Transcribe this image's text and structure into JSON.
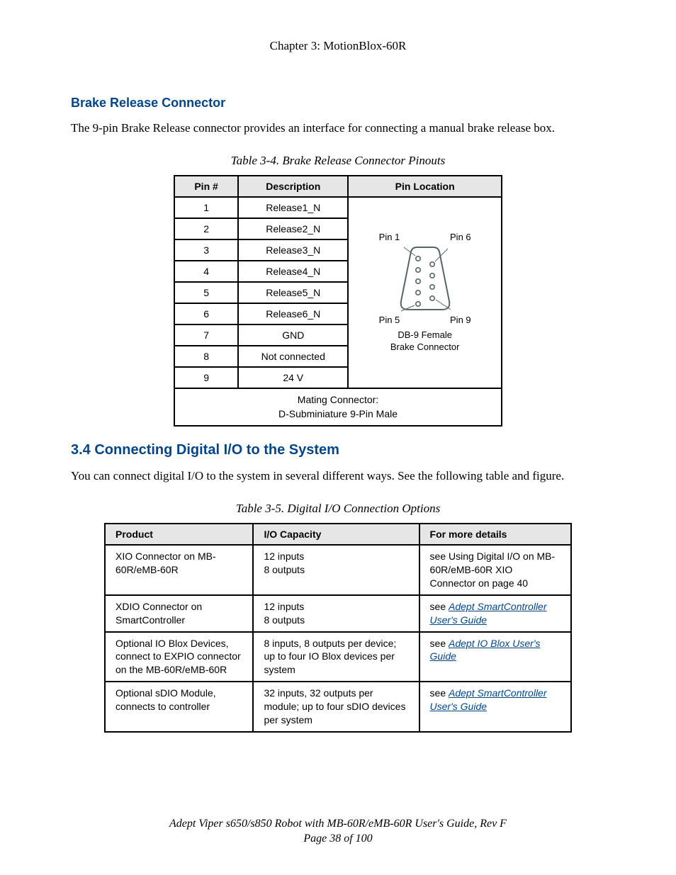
{
  "running_header": "Chapter 3:  MotionBlox-60R",
  "subheading": "Brake Release Connector",
  "intro_para": "The 9-pin Brake Release connector provides an interface for connecting a manual brake release box.",
  "table34": {
    "caption": "Table 3-4. Brake Release Connector Pinouts",
    "headers": {
      "pin": "Pin #",
      "desc": "Description",
      "loc": "Pin Location"
    },
    "rows": [
      {
        "pin": "1",
        "desc": "Release1_N"
      },
      {
        "pin": "2",
        "desc": "Release2_N"
      },
      {
        "pin": "3",
        "desc": "Release3_N"
      },
      {
        "pin": "4",
        "desc": "Release4_N"
      },
      {
        "pin": "5",
        "desc": "Release5_N"
      },
      {
        "pin": "6",
        "desc": "Release6_N"
      },
      {
        "pin": "7",
        "desc": "GND"
      },
      {
        "pin": "8",
        "desc": "Not connected"
      },
      {
        "pin": "9",
        "desc": "24 V"
      }
    ],
    "figure": {
      "top_left": "Pin 1",
      "top_right": "Pin 6",
      "bot_left": "Pin 5",
      "bot_right": "Pin 9",
      "caption1": "DB-9 Female",
      "caption2": "Brake Connector"
    },
    "mating_line1": "Mating Connector:",
    "mating_line2": "D-Subminiature 9-Pin Male"
  },
  "section34": {
    "heading": "3.4  Connecting Digital I/O to the System",
    "para": "You can connect digital I/O to the system in several different ways. See the following table and figure."
  },
  "table35": {
    "caption": "Table 3-5. Digital I/O Connection Options",
    "headers": {
      "product": "Product",
      "capacity": "I/O Capacity",
      "details": "For more details"
    },
    "rows": [
      {
        "product": "XIO Connector on MB-60R/eMB-60R",
        "capacity_l1": "12 inputs",
        "capacity_l2": "8 outputs",
        "details_pre": "see Using Digital I/O on MB-60R/eMB-60R XIO Connector on page 40",
        "details_link": ""
      },
      {
        "product": "XDIO Connector on SmartController",
        "capacity_l1": "12 inputs",
        "capacity_l2": "8 outputs",
        "details_pre": "see ",
        "details_link": "Adept SmartController User's Guide"
      },
      {
        "product": "Optional IO Blox Devices, connect to EXPIO connector on the MB-60R/eMB-60R",
        "capacity_l1": "8 inputs, 8 outputs per device; up to four IO Blox devices per system",
        "capacity_l2": "",
        "details_pre": "see ",
        "details_link": "Adept IO Blox User's Guide"
      },
      {
        "product": "Optional sDIO Module, connects to controller",
        "capacity_l1": "32 inputs, 32 outputs per module; up to four sDIO devices per system",
        "capacity_l2": "",
        "details_pre": "see ",
        "details_link": "Adept SmartController User's Guide"
      }
    ]
  },
  "footer": {
    "line1": "Adept Viper s650/s850 Robot with MB-60R/eMB-60R User's Guide, Rev F",
    "line2": "Page 38 of 100"
  }
}
